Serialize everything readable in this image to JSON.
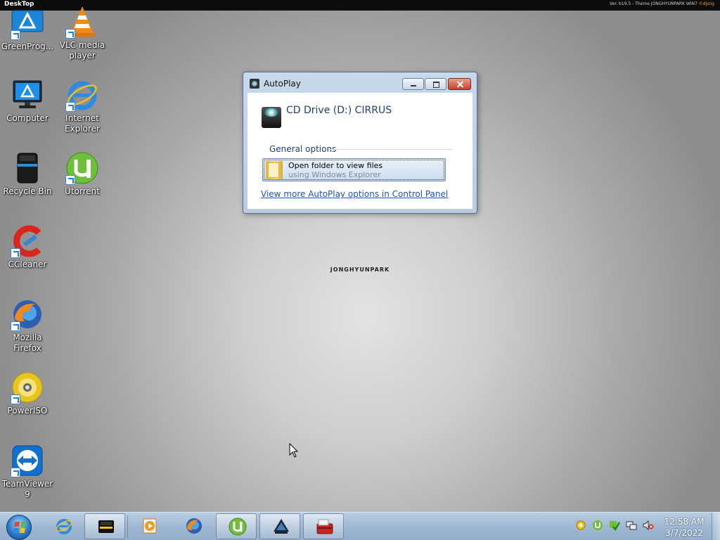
{
  "topbar": {
    "left_label": "DeskTop",
    "right_label": "Ver. b19.5 - Theme JONGHYUNPARK WIN7",
    "right_brand": "©djsng"
  },
  "desktop": {
    "watermark": "JONGHYUNPARK",
    "icons": [
      {
        "label": "GreenProg...",
        "icon": "greenprog-icon"
      },
      {
        "label": "VLC media player",
        "icon": "vlc-icon"
      },
      {
        "label": "Computer",
        "icon": "computer-icon"
      },
      {
        "label": "Internet Explorer",
        "icon": "internet-explorer-icon"
      },
      {
        "label": "Recycle Bin",
        "icon": "recycle-bin-icon"
      },
      {
        "label": "Utorrent",
        "icon": "utorrent-icon"
      },
      {
        "label": "CCleaner",
        "icon": "ccleaner-icon"
      },
      {
        "label": "Mozilla Firefox",
        "icon": "firefox-icon"
      },
      {
        "label": "PowerISO",
        "icon": "poweriso-icon"
      },
      {
        "label": "TeamViewer 9",
        "icon": "teamviewer-icon"
      }
    ]
  },
  "autoplay": {
    "title": "AutoPlay",
    "drive_title": "CD Drive (D:) CIRRUS",
    "section_label": "General options",
    "option_title": "Open folder to view files",
    "option_subtitle": "using Windows Explorer",
    "control_panel_link": "View more AutoPlay options in Control Panel"
  },
  "taskbar": {
    "pinned": [
      {
        "name": "internet-explorer",
        "icon": "internet-explorer-icon",
        "active": false
      },
      {
        "name": "cd-drive",
        "icon": "cd-drive-icon",
        "active": true
      },
      {
        "name": "media-player",
        "icon": "media-player-icon",
        "active": false
      },
      {
        "name": "firefox",
        "icon": "firefox-icon",
        "active": false
      },
      {
        "name": "utorrent",
        "icon": "utorrent-icon",
        "active": true
      },
      {
        "name": "app-dark",
        "icon": "app-icon",
        "active": true
      },
      {
        "name": "toolbox",
        "icon": "toolbox-icon",
        "active": true
      }
    ],
    "clock_time": "12:58 AM",
    "clock_date": "3/7/2022"
  },
  "colors": {
    "link": "#1a53c6",
    "heading": "#1e3f78",
    "taskbar": "#9fb8d2"
  }
}
